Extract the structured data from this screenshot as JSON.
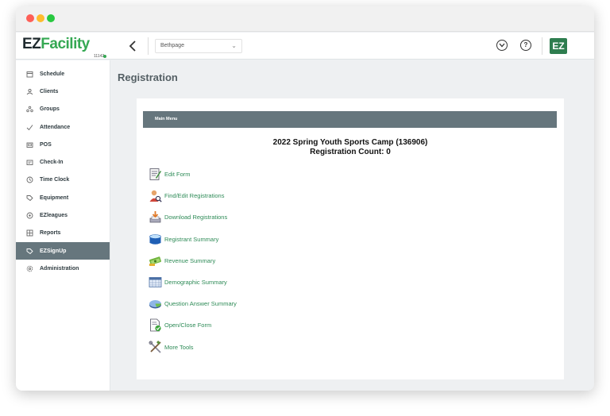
{
  "window": {
    "traffic_lights": [
      "close",
      "minimize",
      "zoom"
    ]
  },
  "header": {
    "logo_ez": "EZ",
    "logo_facility": "Facility",
    "version": "11142",
    "location": "Bethpage",
    "avatar_text": "EZ"
  },
  "sidebar": {
    "items": [
      {
        "label": "Schedule",
        "icon": "calendar-icon"
      },
      {
        "label": "Clients",
        "icon": "clients-icon"
      },
      {
        "label": "Groups",
        "icon": "groups-icon"
      },
      {
        "label": "Attendance",
        "icon": "check-icon"
      },
      {
        "label": "POS",
        "icon": "pos-icon"
      },
      {
        "label": "Check-In",
        "icon": "id-card-icon"
      },
      {
        "label": "Time Clock",
        "icon": "clock-icon"
      },
      {
        "label": "Equipment",
        "icon": "tag-icon"
      },
      {
        "label": "EZleagues",
        "icon": "ball-icon"
      },
      {
        "label": "Reports",
        "icon": "grid-icon"
      },
      {
        "label": "EZSignUp",
        "icon": "tag-icon"
      },
      {
        "label": "Administration",
        "icon": "gear-icon"
      }
    ],
    "active": "EZSignUp"
  },
  "main": {
    "page_title": "Registration",
    "menu_bar_label": "Main Menu",
    "camp_title": "2022 Spring Youth Sports Camp (136906)",
    "registration_count": "Registration Count: 0",
    "menu_items": [
      {
        "label": "Edit Form",
        "icon": "edit-form-icon"
      },
      {
        "label": "Find/Edit Registrations",
        "icon": "find-person-icon"
      },
      {
        "label": "Download Registrations",
        "icon": "download-icon"
      },
      {
        "label": "Registrant Summary",
        "icon": "registrant-summary-icon"
      },
      {
        "label": "Revenue Summary",
        "icon": "revenue-icon"
      },
      {
        "label": "Demographic Summary",
        "icon": "demographic-icon"
      },
      {
        "label": "Question Answer Summary",
        "icon": "pie-icon"
      },
      {
        "label": "Open/Close Form",
        "icon": "open-close-form-icon"
      },
      {
        "label": "More Tools",
        "icon": "tools-icon"
      }
    ]
  },
  "colors": {
    "brand_green": "#35a853",
    "link_green": "#2e8b57",
    "slate": "#66767d",
    "background": "#eef0f2"
  }
}
